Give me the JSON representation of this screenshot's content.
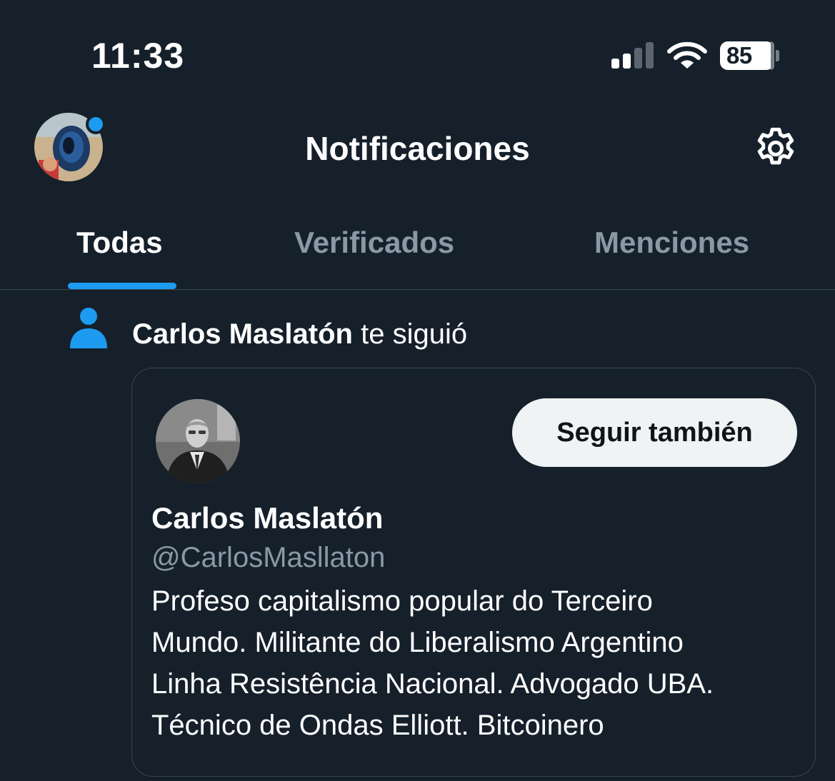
{
  "status_bar": {
    "time": "11:33",
    "battery": "85",
    "signal_icon": "cellular-signal-icon",
    "wifi_icon": "wifi-icon"
  },
  "header": {
    "title": "Notificaciones",
    "settings_icon": "gear-icon"
  },
  "tabs": [
    {
      "label": "Todas",
      "active": true
    },
    {
      "label": "Verificados",
      "active": false
    },
    {
      "label": "Menciones",
      "active": false
    }
  ],
  "notification": {
    "icon": "person-icon",
    "actor": "Carlos Maslatón",
    "action": "te siguió",
    "card": {
      "follow_back_label": "Seguir también",
      "name": "Carlos Maslatón",
      "handle": "@CarlosMasllaton",
      "bio_lines": [
        "Profeso capitalismo popular do Terceiro",
        "Mundo. Militante do Liberalismo Argentino",
        "Linha Resistência Nacional. Advogado UBA.",
        "Técnico de Ondas Elliott. Bitcoinero"
      ]
    }
  },
  "colors": {
    "background": "#15202b",
    "accent": "#1d9bf0",
    "secondary_text": "#8b98a5",
    "border": "#38444d",
    "button_bg": "#eff3f4"
  }
}
